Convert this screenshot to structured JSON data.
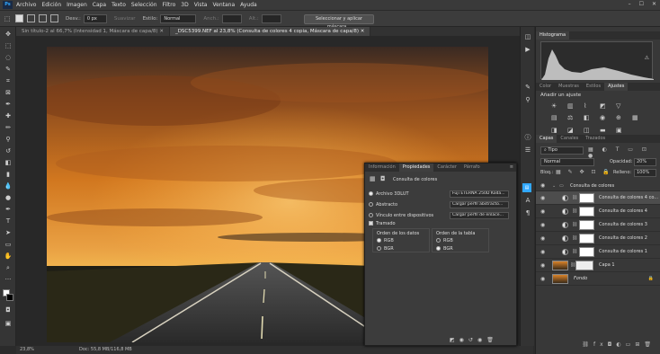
{
  "app": {
    "logo": "Ps"
  },
  "menu": [
    "Archivo",
    "Edición",
    "Imagen",
    "Capa",
    "Texto",
    "Selección",
    "Filtro",
    "3D",
    "Vista",
    "Ventana",
    "Ayuda"
  ],
  "window_controls": [
    "–",
    "☐",
    "✕"
  ],
  "options": {
    "desv_label": "Desv.:",
    "desv_value": "0 px",
    "suavizar": "Suavizar",
    "estilo_label": "Estilo:",
    "estilo_value": "Normal",
    "anch": "Anch.:",
    "alt": "Alt.:",
    "select_mask_button": "Seleccionar y aplicar máscara..."
  },
  "tabs": [
    {
      "label": "Sin título-2 al 66,7% (Intensidad 1, Máscara de capa/8) ✕"
    },
    {
      "label": "_DSC5399.NEF al 23,8% (Consulta de colores 4 copia, Máscara de capa/8) ✕"
    }
  ],
  "status": {
    "zoom": "23,8%",
    "doc": "Doc: 55,8 MB/116,8 MB"
  },
  "histogram": {
    "title": "Histograma"
  },
  "adjust_tabs": [
    "Color",
    "Muestras",
    "Estilos",
    "Ajustes"
  ],
  "adjust_add_label": "Añadir un ajuste",
  "layers_panel": {
    "tabs": [
      "Capas",
      "Canales",
      "Trazados"
    ],
    "filter_label": "Tipo",
    "blend_mode": "Normal",
    "opacity_label": "Opacidad:",
    "opacity_value": "20%",
    "lock_label": "Bloq.:",
    "fill_label": "Relleno:",
    "fill_value": "100%",
    "group_name": "Consulta de colores",
    "layers": [
      {
        "name": "Consulta de colores 4 co..."
      },
      {
        "name": "Consulta de colores 4"
      },
      {
        "name": "Consulta de colores 3"
      },
      {
        "name": "Consulta de colores 2"
      },
      {
        "name": "Consulta de colores 1"
      },
      {
        "name": "Capa 1"
      },
      {
        "name": "Fondo"
      }
    ]
  },
  "properties": {
    "tabs": [
      "Información",
      "Propiedades",
      "Carácter",
      "Párrafo"
    ],
    "title": "Consulta de colores",
    "options": [
      {
        "label": "Archivo 3DLUT",
        "value": "Fuji ETERNA 250D Koda..."
      },
      {
        "label": "Abstracto",
        "value": "Cargar perfil abstracto..."
      },
      {
        "label": "Vínculo entre dispositivos",
        "value": "Cargar perfil de enlace..."
      }
    ],
    "dither": "Tramado",
    "data_order_title": "Orden de los datos",
    "table_order_title": "Orden de la tabla",
    "rgb": "RGB",
    "bgr": "BGR"
  }
}
